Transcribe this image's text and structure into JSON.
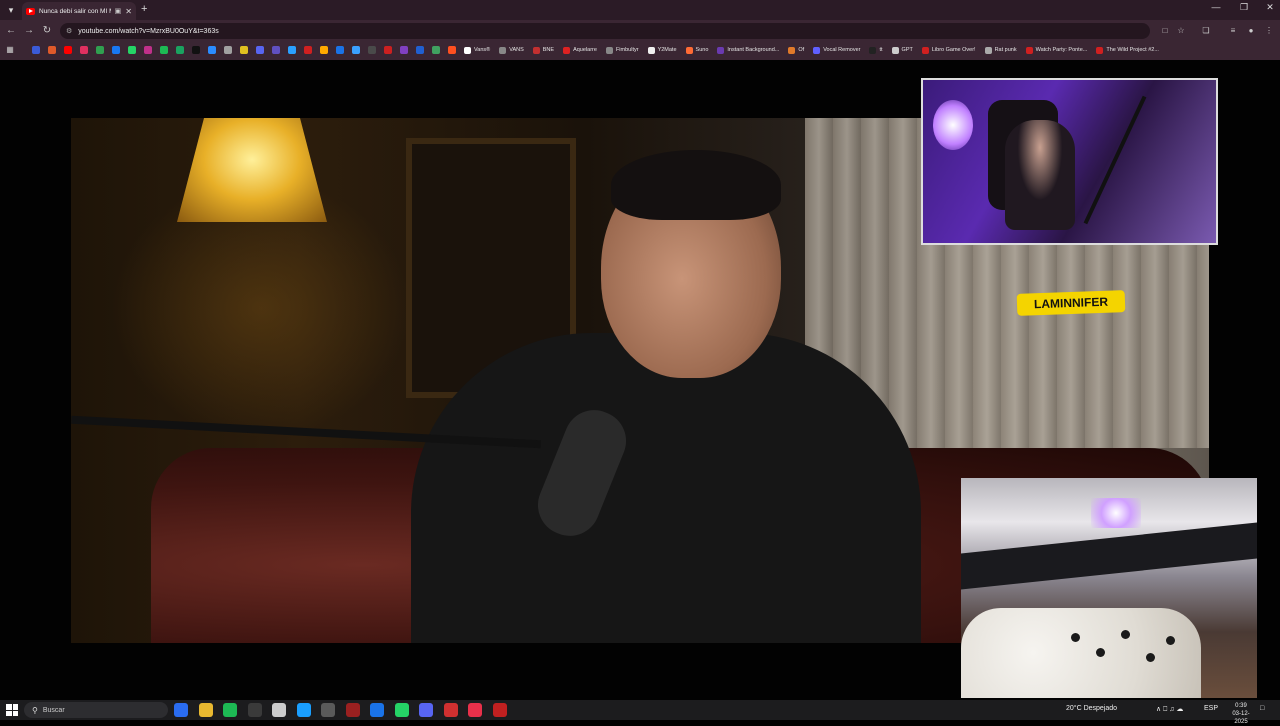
{
  "browser": {
    "tab_title": "Nunca debí salir con MI M",
    "url": "youtube.com/watch?v=MzrxBU0OuY&t=363s",
    "new_tab_symbol": "+",
    "bookmarks": [
      {
        "label": "Vans®",
        "color": "#ffffff"
      },
      {
        "label": "VANS",
        "color": "#888888"
      },
      {
        "label": "BNE",
        "color": "#c23030"
      },
      {
        "label": "Aquelarre",
        "color": "#d22"
      },
      {
        "label": "Fimbultyr",
        "color": "#888888"
      },
      {
        "label": "Y2Mate",
        "color": "#f0f0f0"
      },
      {
        "label": "Suno",
        "color": "#ff6b35"
      },
      {
        "label": "Instant Background...",
        "color": "#6a3ab0"
      },
      {
        "label": "Of",
        "color": "#e07a2a"
      },
      {
        "label": "Vocal Remover",
        "color": "#6060ff"
      },
      {
        "label": "tt",
        "color": "#222222"
      },
      {
        "label": "GPT",
        "color": "#cccccc"
      },
      {
        "label": "Libro Game Over!",
        "color": "#d02020"
      },
      {
        "label": "Rat punk",
        "color": "#aaaaaa"
      },
      {
        "label": "Watch Party: Ponte...",
        "color": "#d02020"
      },
      {
        "label": "The Wild Project #2...",
        "color": "#d02020"
      }
    ],
    "icon_bookmark_colors": [
      "#3b5bd8",
      "#e05a2a",
      "#ff0000",
      "#e03060",
      "#30a050",
      "#1877f2",
      "#25d366",
      "#c0308a",
      "#1db954",
      "#1aa260",
      "#111111",
      "#2a8cff",
      "#a0a0a0",
      "#e0c020",
      "#5865f2",
      "#6050c0",
      "#2aa0ff",
      "#d02020",
      "#ffaa00",
      "#1a73e8",
      "#3aa0ff",
      "#4a4a4a",
      "#cc2020",
      "#8040c0",
      "#2060d0",
      "#40a060",
      "#ff5020"
    ]
  },
  "overlay": {
    "streamer_name": "LAMINNIFER"
  },
  "taskbar": {
    "search_placeholder": "Buscar",
    "weather": "20°C  Despejado",
    "language": "ESP",
    "time": "0:39",
    "date": "03-12-2025",
    "app_colors": [
      "#2a6cf0",
      "#e8b830",
      "#1db954",
      "#3a3a3a",
      "#cccccc",
      "#1a9fff",
      "#5a5a5a",
      "#9a2020",
      "#1a73e8",
      "#25d366",
      "#5865f2",
      "#d03030",
      "#e8304a",
      "#c02020"
    ]
  }
}
